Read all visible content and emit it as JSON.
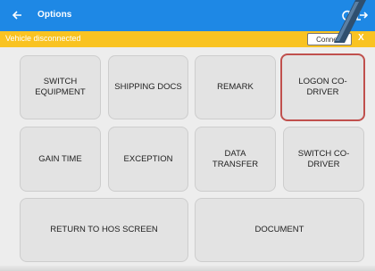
{
  "appbar": {
    "title": "Options",
    "back_icon": "arrow-left-icon",
    "refresh_icon": "refresh-icon",
    "logout_icon": "logout-icon",
    "color": "#1e88e5"
  },
  "status": {
    "message": "Vehicle disconnected",
    "connect_label": "Connect",
    "close_label": "X",
    "color": "#f9c322"
  },
  "buttons": [
    {
      "label": "SWITCH EQUIPMENT"
    },
    {
      "label": "SHIPPING DOCS"
    },
    {
      "label": "REMARK"
    },
    {
      "label": "LOGON CO-DRIVER",
      "highlighted": true
    },
    {
      "label": "GAIN TIME"
    },
    {
      "label": "EXCEPTION"
    },
    {
      "label": "DATA TRANSFER"
    },
    {
      "label": "SWITCH CO-DRIVER"
    },
    {
      "label": "RETURN TO HOS SCREEN"
    },
    {
      "label": "DOCUMENT"
    }
  ],
  "highlight_color": "#c0504d"
}
